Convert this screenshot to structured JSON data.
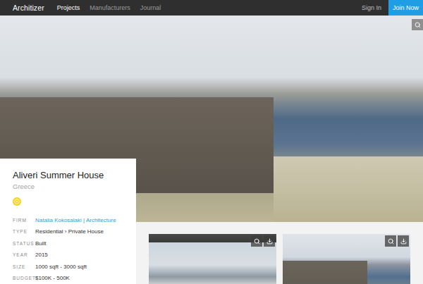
{
  "nav": {
    "logo": "Architizer",
    "links": [
      {
        "label": "Projects",
        "selected": true
      },
      {
        "label": "Manufacturers",
        "selected": false
      },
      {
        "label": "Journal",
        "selected": false
      }
    ],
    "sign_in": "Sign In",
    "join": "Join Now"
  },
  "project": {
    "title": "Aliveri Summer House",
    "location": "Greece",
    "details": [
      {
        "label": "FIRM",
        "value": "Natalia Kokosalaki | Architecture",
        "link": true
      },
      {
        "label": "TYPE",
        "value": "Residential › Private House",
        "link": false
      },
      {
        "label": "STATUS",
        "value": "Built",
        "link": false
      },
      {
        "label": "YEAR",
        "value": "2015",
        "link": false
      },
      {
        "label": "SIZE",
        "value": "1000 sqft - 3000 sqft",
        "link": false
      },
      {
        "label": "BUDGET",
        "value": "$100K - 500K",
        "link": false
      }
    ]
  },
  "gallery": [
    {
      "kind": "terrace"
    },
    {
      "kind": "wall"
    }
  ]
}
